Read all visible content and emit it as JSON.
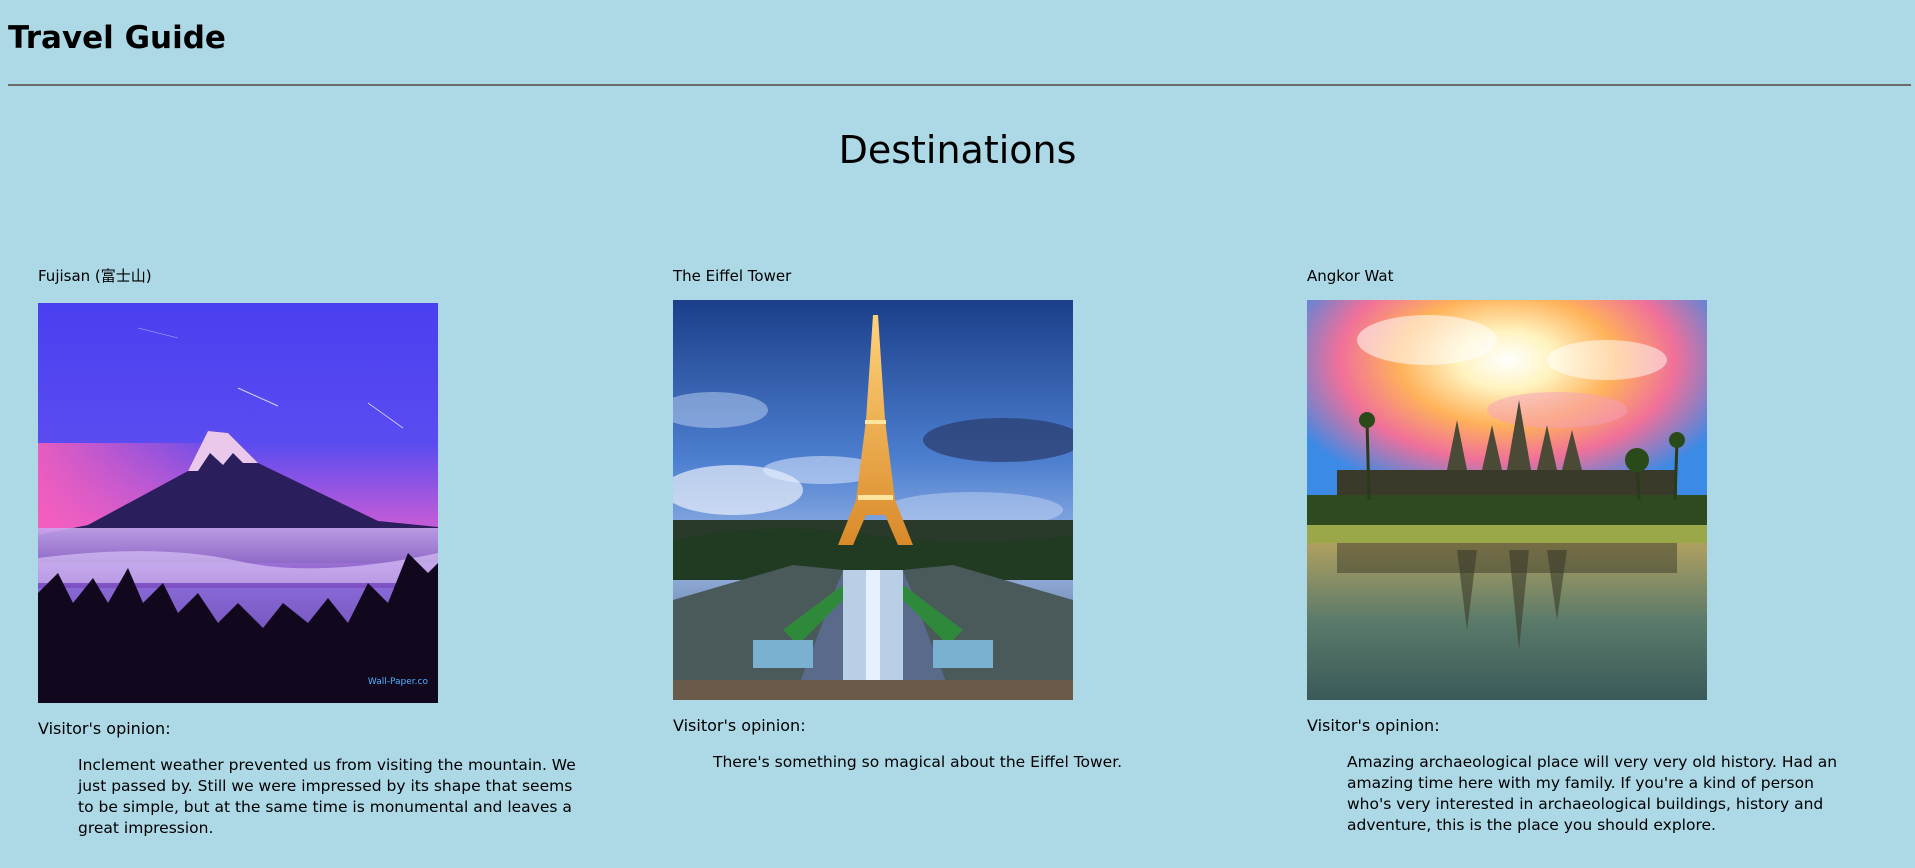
{
  "header": {
    "title": "Travel Guide"
  },
  "main": {
    "heading": "Destinations",
    "destinations": [
      {
        "name": "Fujisan (富士山)",
        "image": "mount-fuji-photo",
        "watermark": "Wall-Paper.co",
        "opinion_label": "Visitor's opinion:",
        "opinion": "Inclement weather prevented us from visiting the mountain. We just passed by. Still we were impressed by its shape that seems to be simple, but at the same time is monumental and leaves a great impression."
      },
      {
        "name": "The Eiffel Tower",
        "image": "eiffel-tower-photo",
        "opinion_label": "Visitor's opinion:",
        "opinion": "There's something so magical about the Eiffel Tower."
      },
      {
        "name": "Angkor Wat",
        "image": "angkor-wat-photo",
        "opinion_label": "Visitor's opinion:",
        "opinion": "Amazing archaeological place will very very old history. Had an amazing time here with my family. If you're a kind of person who's very interested in archaeological buildings, history and adventure, this is the place you should explore."
      }
    ]
  },
  "colors": {
    "background": "#add8e6",
    "rule": "#6b6b6b"
  }
}
